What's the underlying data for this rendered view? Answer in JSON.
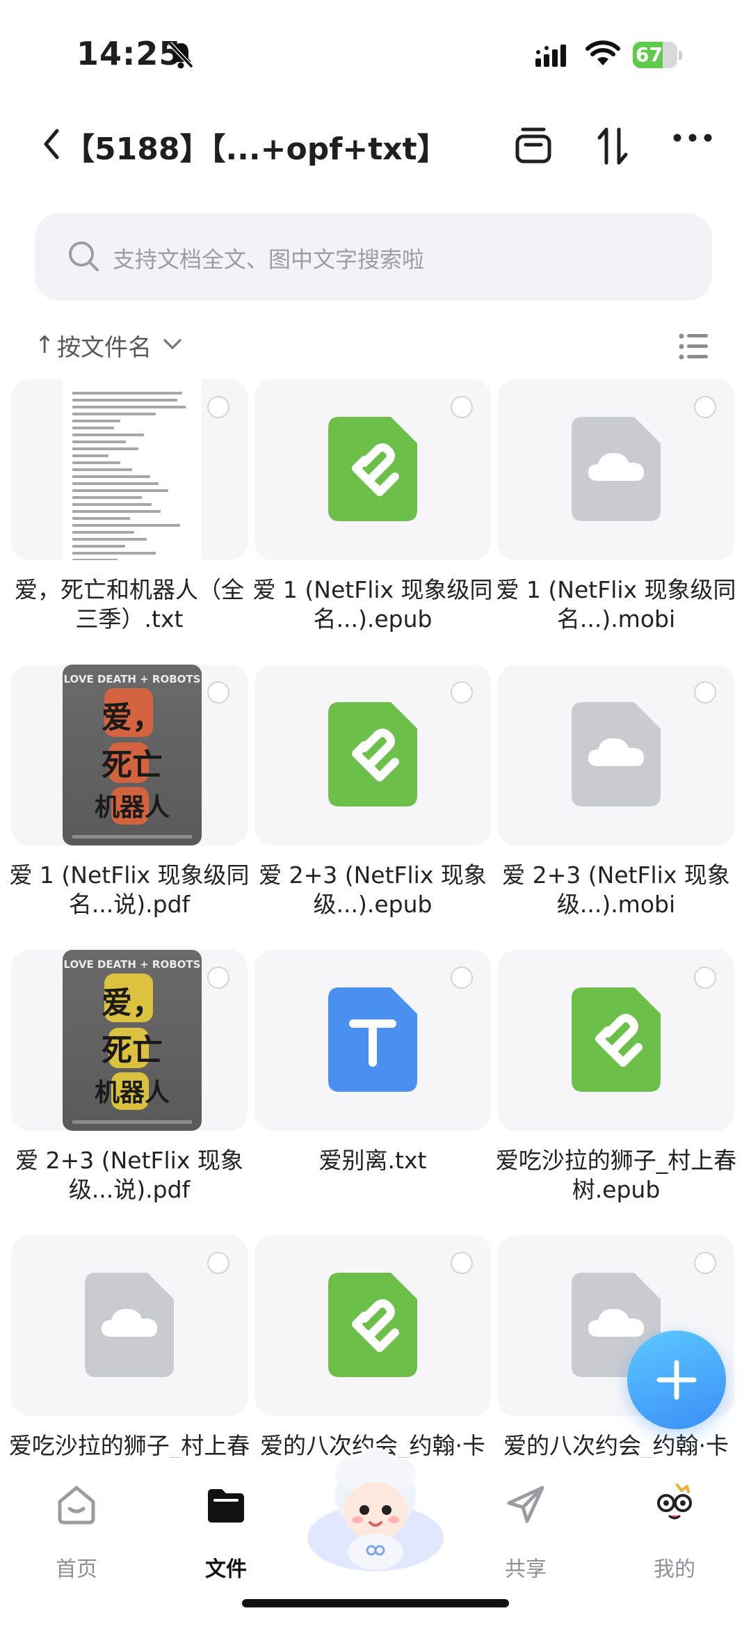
{
  "status_bar": {
    "time": "14:25",
    "battery_text": "67",
    "battery_level": 0.67
  },
  "header": {
    "back_icon": "chevron-left-icon",
    "title": "【5188】【...+opf+txt】",
    "icons": [
      "archive-box-icon",
      "sort-updown-icon",
      "more-dots-icon"
    ]
  },
  "search": {
    "placeholder": "支持文档全文、图中文字搜索啦"
  },
  "sort": {
    "arrow": "↑",
    "label": "按文件名"
  },
  "files": [
    {
      "name": "爱，死亡和机器人（全三季）.txt",
      "type": "txt-preview"
    },
    {
      "name": "爱 1 (NetFlix 现象级同名...).epub",
      "type": "epub"
    },
    {
      "name": "爱 1 (NetFlix 现象级同名...).mobi",
      "type": "cloud"
    },
    {
      "name": "爱 1 (NetFlix 现象级同名...说).pdf",
      "type": "cover-orange"
    },
    {
      "name": "爱 2+3 (NetFlix 现象级...).epub",
      "type": "epub"
    },
    {
      "name": "爱 2+3 (NetFlix 现象级...).mobi",
      "type": "cloud"
    },
    {
      "name": "爱 2+3 (NetFlix 现象级...说).pdf",
      "type": "cover-yellow"
    },
    {
      "name": "爱别离.txt",
      "type": "txt"
    },
    {
      "name": "爱吃沙拉的狮子_村上春树.epub",
      "type": "epub"
    },
    {
      "name": "爱吃沙拉的狮子_村上春树.mobi",
      "type": "cloud"
    },
    {
      "name": "爱的八次约会_约翰·卡特勒.epub",
      "type": "epub"
    },
    {
      "name": "爱的八次约会_约翰·卡特勒.mobi",
      "type": "cloud"
    }
  ],
  "cover": {
    "title": "LOVE DEATH + ROBOTS",
    "chars": [
      "爱，",
      "死亡",
      "机器人"
    ]
  },
  "bottom_nav": [
    {
      "label": "首页",
      "icon": "home-icon",
      "active": false
    },
    {
      "label": "文件",
      "icon": "folder-icon",
      "active": true
    },
    {
      "label": "",
      "icon": "mascot-icon",
      "active": false
    },
    {
      "label": "共享",
      "icon": "send-icon",
      "active": false
    },
    {
      "label": "我的",
      "icon": "profile-face-icon",
      "active": false
    }
  ],
  "colors": {
    "epub_green": "#6cc04a",
    "txt_blue": "#4a90f0",
    "cloud_gray": "#c9cbd0",
    "fab_blue": "#3a8ff7"
  }
}
